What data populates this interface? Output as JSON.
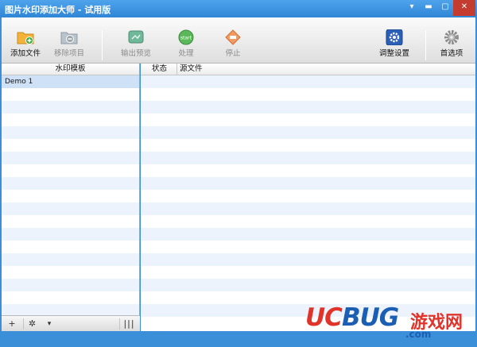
{
  "window": {
    "title": "图片水印添加大师 - 试用版",
    "controls": {
      "menu": "▾",
      "minimize": "▬",
      "maximize": "▢",
      "close": "✕"
    }
  },
  "toolbar": {
    "add_file": "添加文件",
    "remove_item": "移除项目",
    "preview": "输出预览",
    "process": "处理",
    "stop": "停止",
    "adjust_settings": "调整设置",
    "preferences": "首选项",
    "process_icon_text": "start"
  },
  "left_panel": {
    "header": "水印模板",
    "items": [
      {
        "label": "Demo 1"
      }
    ],
    "footer": {
      "add": "+",
      "gear": "✲",
      "dropdown": "▾",
      "grip": "|||"
    }
  },
  "right_panel": {
    "columns": {
      "status": "状态",
      "source": "源文件"
    }
  },
  "watermark": {
    "uc": "UC",
    "bug": "BUG",
    "cn": "游戏网",
    "domain": ".com"
  },
  "colors": {
    "title_bar": "#2f86d6",
    "row_alt": "#edf3fc",
    "row_selected": "#cfe1f6",
    "status_bar": "#3b8fd8"
  }
}
